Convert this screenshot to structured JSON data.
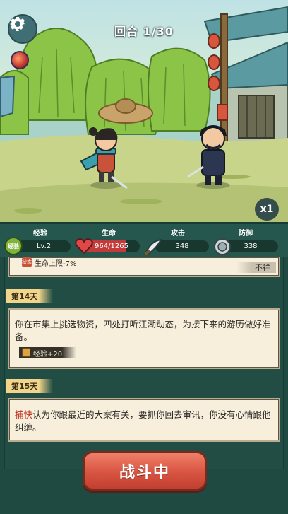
{
  "scene": {
    "round_text": "回合 1/30",
    "speed_label": "x1"
  },
  "stats": {
    "exp": {
      "label": "经验",
      "value": "Lv.2",
      "icon_text": "经验"
    },
    "hp": {
      "label": "生命",
      "value": "964/1265",
      "current": 964,
      "max": 1265
    },
    "attack": {
      "label": "攻击",
      "value": "348"
    },
    "defense": {
      "label": "防御",
      "value": "338"
    }
  },
  "log": {
    "prev_effect": {
      "text": "生命上限-7%",
      "result": "不祥",
      "icon_text": "状态"
    },
    "entries": [
      {
        "day": "第14天",
        "text": "你在市集上挑选物资，四处打听江湖动态，为接下来的游历做好准备。",
        "reward": "经验+20"
      },
      {
        "day": "第15天",
        "highlight": "捕快",
        "text": "认为你跟最近的大案有关，要抓你回去审讯，你没有心情跟他纠缠。"
      }
    ]
  },
  "battle_button": "战斗中",
  "colors": {
    "panel": "#25574e",
    "card": "#f7efdc",
    "button": "#d85442",
    "highlight": "#c0321e",
    "day_tag": "#f2d58a"
  }
}
